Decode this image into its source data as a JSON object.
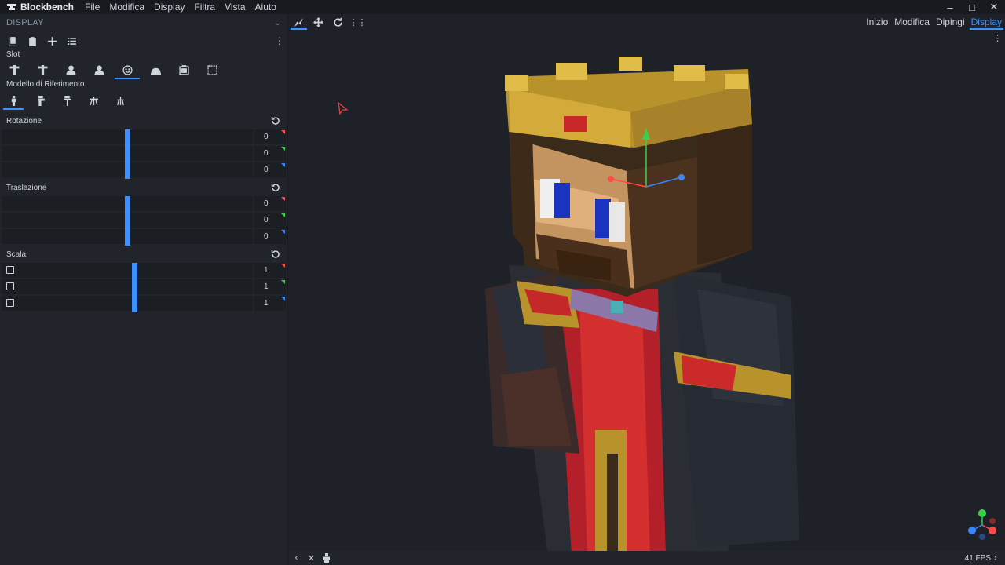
{
  "app": {
    "title": "Blockbench"
  },
  "menu": [
    "File",
    "Modifica",
    "Display",
    "Filtra",
    "Vista",
    "Aiuto"
  ],
  "window_controls": [
    "minimize-icon",
    "maximize-icon",
    "close-icon"
  ],
  "panel": {
    "title": "DISPLAY",
    "slot_label": "Slot",
    "reference_label": "Modello di Riferimento",
    "slots": [
      {
        "icon": "thirdperson-right-icon",
        "selected": false
      },
      {
        "icon": "thirdperson-left-icon",
        "selected": false
      },
      {
        "icon": "firstperson-right-icon",
        "selected": false
      },
      {
        "icon": "firstperson-left-icon",
        "selected": false
      },
      {
        "icon": "head-icon",
        "selected": true
      },
      {
        "icon": "ground-icon",
        "selected": false
      },
      {
        "icon": "item-frame-icon",
        "selected": false
      },
      {
        "icon": "gui-icon",
        "selected": false
      }
    ],
    "references": [
      {
        "icon": "player-icon",
        "selected": true
      },
      {
        "icon": "zombie-icon",
        "selected": false
      },
      {
        "icon": "armor-stand-icon",
        "selected": false
      },
      {
        "icon": "baby-icon",
        "selected": false
      },
      {
        "icon": "armor-stand-small-icon",
        "selected": false
      }
    ],
    "rotation": {
      "label": "Rotazione",
      "values": [
        "0",
        "0",
        "0"
      ],
      "fraction": 0.5
    },
    "translation": {
      "label": "Traslazione",
      "values": [
        "0",
        "0",
        "0"
      ],
      "fraction": 0.5
    },
    "scale": {
      "label": "Scala",
      "values": [
        "1",
        "1",
        "1"
      ],
      "fraction": 0.53
    }
  },
  "modes": [
    {
      "label": "Inizio",
      "selected": false
    },
    {
      "label": "Modifica",
      "selected": false
    },
    {
      "label": "Dipingi",
      "selected": false
    },
    {
      "label": "Display",
      "selected": true
    }
  ],
  "status": {
    "fps": "41 FPS"
  },
  "colors": {
    "accent": "#3e90ff",
    "axis_x": "#ff4a4a",
    "axis_y": "#3cd04a",
    "axis_z": "#3a86ff"
  }
}
